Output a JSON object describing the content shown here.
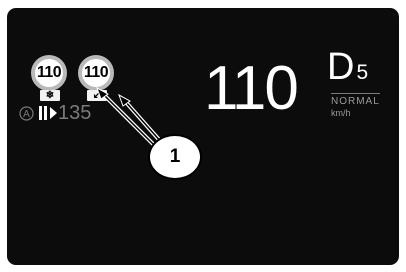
{
  "speed_signs": [
    {
      "value": "110",
      "sub_icon": "snowflake-icon",
      "sub_symbol": "❄"
    },
    {
      "value": "110",
      "sub_icon": "arrow-down-left-icon",
      "sub_symbol": "↙"
    }
  ],
  "limiter": {
    "auto_label": "A",
    "set_speed": "135"
  },
  "speedometer": {
    "current_speed": "110",
    "gear_letter": "D",
    "gear_number": "5",
    "drive_mode": "NORMAL",
    "unit": "km/h"
  },
  "callout": {
    "number": "1"
  },
  "colors": {
    "screen_bg": "#0c0c0c",
    "text_primary": "#ffffff",
    "text_muted": "#7a7a7a",
    "sign_border": "#b9b9b9"
  }
}
